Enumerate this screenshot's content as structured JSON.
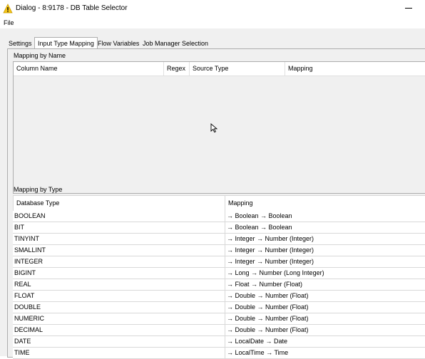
{
  "window": {
    "title": "Dialog - 8:9178 - DB Table Selector"
  },
  "menu": {
    "file": "File"
  },
  "tabs": [
    {
      "label": "Settings",
      "active": false
    },
    {
      "label": "Input Type Mapping",
      "active": true
    },
    {
      "label": "Flow Variables",
      "active": false
    },
    {
      "label": "Job Manager Selection",
      "active": false
    }
  ],
  "mapping_by_name": {
    "title": "Mapping by Name",
    "columns": [
      "Column Name",
      "Regex",
      "Source Type",
      "Mapping"
    ]
  },
  "mapping_by_type": {
    "title": "Mapping by Type",
    "columns": [
      "Database Type",
      "Mapping"
    ],
    "rows": [
      {
        "type": "BOOLEAN",
        "mapping": "→ Boolean → Boolean"
      },
      {
        "type": "BIT",
        "mapping": "→ Boolean → Boolean"
      },
      {
        "type": "TINYINT",
        "mapping": "→ Integer → Number (Integer)"
      },
      {
        "type": "SMALLINT",
        "mapping": "→ Integer → Number (Integer)"
      },
      {
        "type": "INTEGER",
        "mapping": "→ Integer → Number (Integer)"
      },
      {
        "type": "BIGINT",
        "mapping": "→ Long → Number (Long Integer)"
      },
      {
        "type": "REAL",
        "mapping": "→ Float → Number (Float)"
      },
      {
        "type": "FLOAT",
        "mapping": "→ Double → Number (Float)"
      },
      {
        "type": "DOUBLE",
        "mapping": "→ Double → Number (Float)"
      },
      {
        "type": "NUMERIC",
        "mapping": "→ Double → Number (Float)"
      },
      {
        "type": "DECIMAL",
        "mapping": "→ Double → Number (Float)"
      },
      {
        "type": "DATE",
        "mapping": "→ LocalDate → Date"
      },
      {
        "type": "TIME",
        "mapping": "→ LocalTime → Time"
      }
    ]
  },
  "colors": {
    "dialog_bg": "#f0f0f0",
    "warning_icon": "#f5c518",
    "border": "#adadad"
  }
}
